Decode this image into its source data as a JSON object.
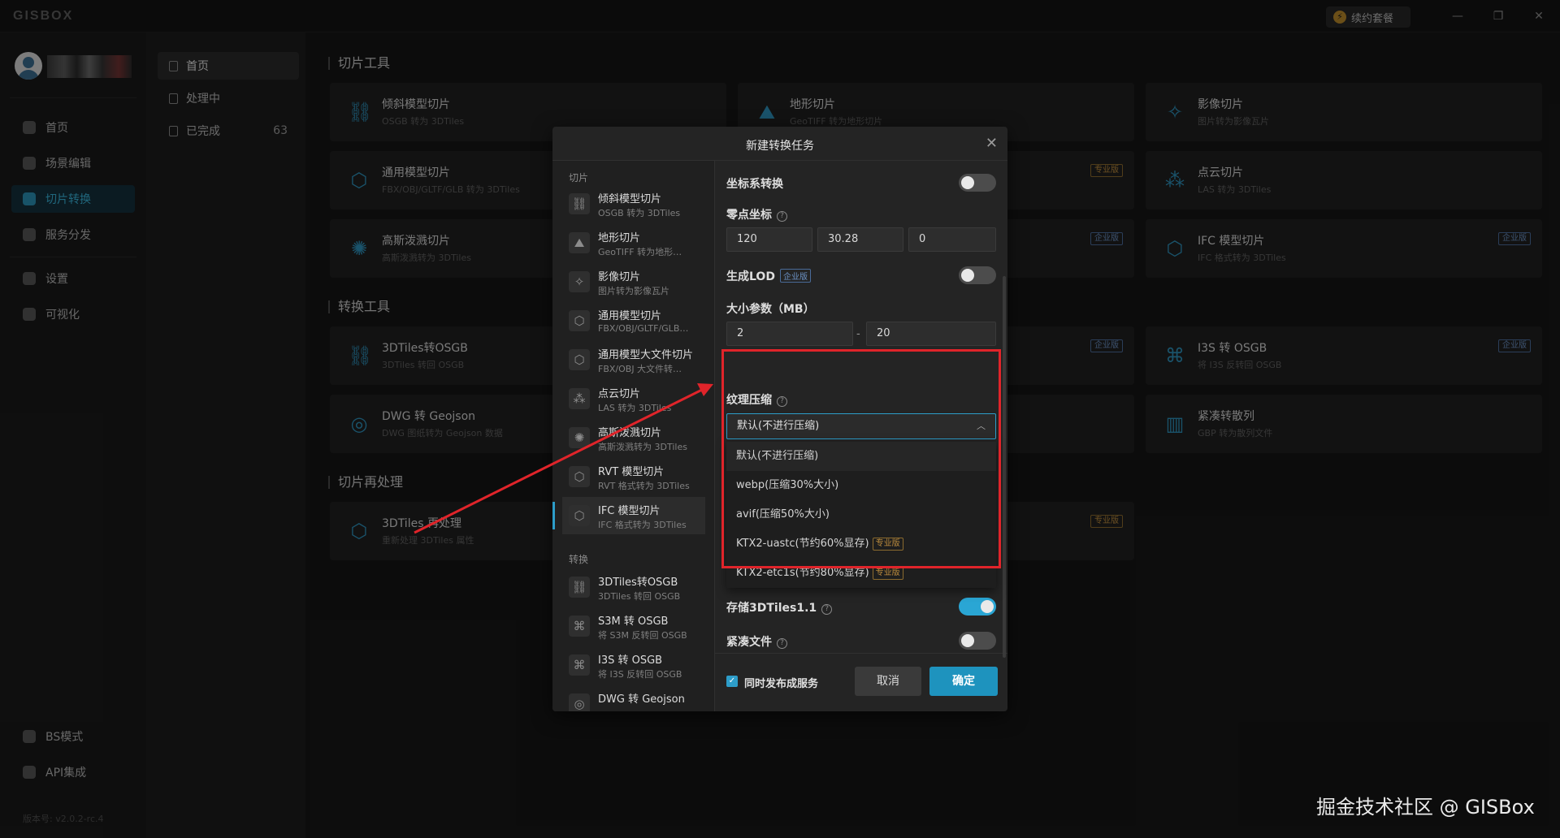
{
  "app": {
    "logo": "GISBOX",
    "renew_label": "续约套餐",
    "version": "版本号: v2.0.2-rc.4"
  },
  "leftnav": {
    "items": [
      {
        "label": "首页",
        "icon": "home-icon"
      },
      {
        "label": "场景编辑",
        "icon": "cube-icon"
      },
      {
        "label": "切片转换",
        "icon": "layers-icon"
      },
      {
        "label": "服务分发",
        "icon": "upload-icon"
      },
      {
        "label": "设置",
        "icon": "gear-icon"
      },
      {
        "label": "可视化",
        "icon": "chart-icon"
      }
    ],
    "bottom": [
      {
        "label": "BS模式",
        "icon": "code-icon"
      },
      {
        "label": "API集成",
        "icon": "api-icon"
      }
    ]
  },
  "subnav": {
    "items": [
      {
        "label": "首页"
      },
      {
        "label": "处理中"
      },
      {
        "label": "已完成",
        "count": "63"
      }
    ]
  },
  "main": {
    "sections": [
      "切片工具",
      "转换工具",
      "切片再处理"
    ],
    "cards": [
      {
        "title": "倾斜模型切片",
        "sub": "OSGB 转为 3DTiles",
        "badge": ""
      },
      {
        "title": "地形切片",
        "sub": "GeoTIFF 转为地形切片",
        "badge": ""
      },
      {
        "title": "影像切片",
        "sub": "图片转为影像瓦片",
        "badge": ""
      },
      {
        "title": "通用模型切片",
        "sub": "FBX/OBJ/GLTF/GLB 转为 3DTiles",
        "badge": ""
      },
      {
        "title": "",
        "sub": "",
        "badge": "专业版"
      },
      {
        "title": "点云切片",
        "sub": "LAS 转为 3DTiles",
        "badge": ""
      },
      {
        "title": "高斯泼溅切片",
        "sub": "高斯泼溅转为 3DTiles",
        "badge": ""
      },
      {
        "title": "",
        "sub": "",
        "badge": "企业版"
      },
      {
        "title": "IFC 模型切片",
        "sub": "IFC 格式转为 3DTiles",
        "badge": "企业版"
      },
      {
        "title": "3DTiles转OSGB",
        "sub": "3DTiles 转回 OSGB",
        "badge": ""
      },
      {
        "title": "",
        "sub": "",
        "badge": "企业版"
      },
      {
        "title": "I3S 转 OSGB",
        "sub": "将 I3S 反转回 OSGB",
        "badge": "企业版"
      },
      {
        "title": "DWG 转 Geojson",
        "sub": "DWG 图纸转为 Geojson 数据",
        "badge": ""
      },
      {
        "title": "",
        "sub": "",
        "badge": ""
      },
      {
        "title": "紧凑转散列",
        "sub": "GBP 转为散列文件",
        "badge": ""
      },
      {
        "title": "3DTiles 再处理",
        "sub": "重新处理 3DTiles 属性",
        "badge": ""
      },
      {
        "title": "",
        "sub": "",
        "badge": "专业版"
      }
    ]
  },
  "dialog": {
    "title": "新建转换任务",
    "groups": [
      "切片",
      "转换"
    ],
    "items": [
      {
        "name": "倾斜模型切片",
        "sub": "OSGB 转为 3DTiles",
        "icon": "tilt-model-icon"
      },
      {
        "name": "地形切片",
        "sub": "GeoTIFF 转为地形…",
        "icon": "terrain-icon"
      },
      {
        "name": "影像切片",
        "sub": "图片转为影像瓦片",
        "icon": "imagery-icon"
      },
      {
        "name": "通用模型切片",
        "sub": "FBX/OBJ/GLTF/GLB…",
        "icon": "cube-icon"
      },
      {
        "name": "通用模型大文件切片",
        "sub": "FBX/OBJ 大文件转…",
        "icon": "cube-icon"
      },
      {
        "name": "点云切片",
        "sub": "LAS 转为 3DTiles",
        "icon": "pointcloud-icon"
      },
      {
        "name": "高斯泼溅切片",
        "sub": "高斯泼溅转为 3DTiles",
        "icon": "gaussian-icon"
      },
      {
        "name": "RVT 模型切片",
        "sub": "RVT 格式转为 3DTiles",
        "icon": "cube-icon"
      },
      {
        "name": "IFC 模型切片",
        "sub": "IFC 格式转为 3DTiles",
        "icon": "cube-icon"
      },
      {
        "name": "3DTiles转OSGB",
        "sub": "3DTiles 转回 OSGB",
        "icon": "convert-icon"
      },
      {
        "name": "S3M 转 OSGB",
        "sub": "将 S3M 反转回 OSGB",
        "icon": "convert-icon"
      },
      {
        "name": "I3S 转 OSGB",
        "sub": "将 I3S 反转回 OSGB",
        "icon": "convert-icon"
      },
      {
        "name": "DWG 转 Geojson",
        "sub": "",
        "icon": "dwg-icon"
      }
    ],
    "form": {
      "coord_transform_label": "坐标系转换",
      "origin_label": "零点坐标",
      "origin_values": [
        "120",
        "30.28",
        "0"
      ],
      "lod_label": "生成LOD",
      "lod_badge": "企业版",
      "size_label": "大小参数（MB）",
      "size_min": "2",
      "size_max": "20",
      "texture_label": "纹理压缩",
      "texture_selected": "默认(不进行压缩)",
      "texture_options": [
        {
          "label": "默认(不进行压缩)",
          "badge": ""
        },
        {
          "label": "webp(压缩30%大小)",
          "badge": ""
        },
        {
          "label": "avif(压缩50%大小)",
          "badge": ""
        },
        {
          "label": "KTX2-uastc(节约60%显存)",
          "badge": "专业版"
        },
        {
          "label": "KTX2-etc1s(节约80%显存)",
          "badge": "专业版"
        }
      ],
      "store_label": "存储3DTiles1.1",
      "compact_label": "紧凑文件"
    },
    "footer": {
      "publish_label": "同时发布成服务",
      "cancel": "取消",
      "ok": "确定"
    }
  },
  "watermark": "掘金技术社区 @ GISBox",
  "colors": {
    "accent": "#2d9dc9",
    "annotation_red": "#e0242a",
    "pro_badge": "#bd8c3d",
    "enterprise_badge": "#6c92c5"
  }
}
